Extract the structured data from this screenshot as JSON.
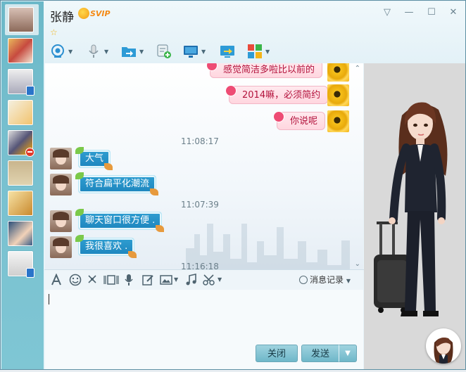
{
  "window": {
    "contact_name": "张静",
    "vip_label": "SVIP",
    "controls": [
      "▽",
      "—",
      "☐",
      "✕"
    ]
  },
  "toolbar": {
    "buttons": [
      "video-call",
      "voice-call",
      "send-file",
      "remote-assist",
      "screen-share",
      "present",
      "apps"
    ]
  },
  "messages": [
    {
      "side": "right",
      "text": "感觉简洁多啦比以前的"
    },
    {
      "side": "right",
      "text": "2014嘛，必须简约"
    },
    {
      "side": "right",
      "text": "你说呢"
    },
    {
      "type": "time",
      "text": "11:08:17"
    },
    {
      "side": "left",
      "text": "大气"
    },
    {
      "side": "left",
      "text": "符合扁平化潮流"
    },
    {
      "type": "time",
      "text": "11:07:39"
    },
    {
      "side": "left",
      "text": "聊天窗口很方便 ."
    },
    {
      "side": "left",
      "text": "我很喜欢 ."
    },
    {
      "type": "time",
      "text": "11:16:18"
    }
  ],
  "input_toolbar": {
    "history_label": "消息记录"
  },
  "buttons": {
    "close": "关闭",
    "send": "发送"
  },
  "colors": {
    "sidebar": "#78c0cf",
    "incoming_bubble": "#1d86be",
    "outgoing_bubble": "#ffd6df",
    "outgoing_text": "#b3123c",
    "button": "#6fb7c9"
  }
}
